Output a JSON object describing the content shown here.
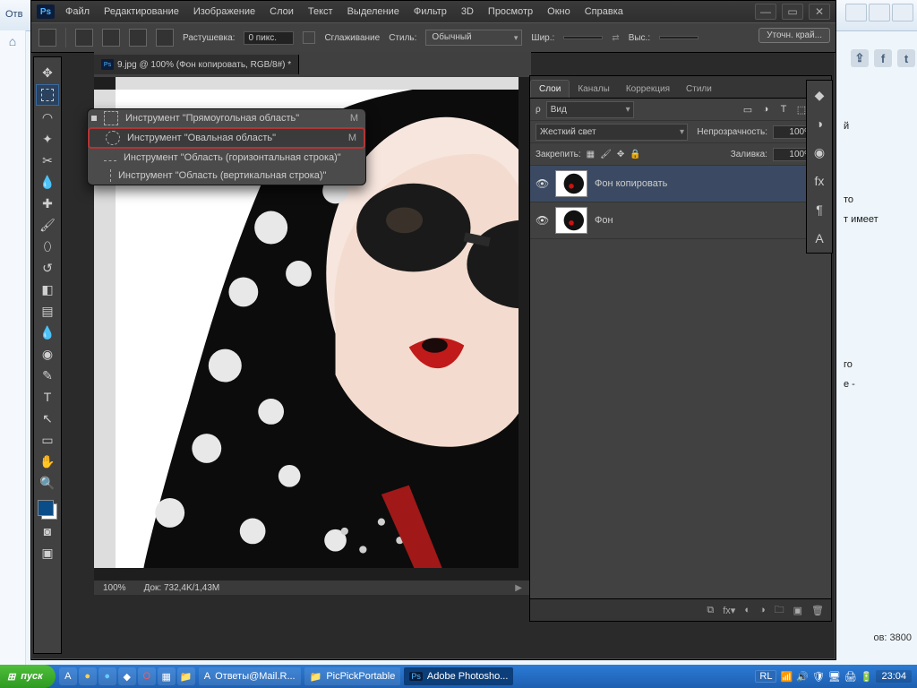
{
  "browser": {
    "left_label": "Отв",
    "side_text_lines": [
      "й",
      "то",
      "т имеет",
      "го",
      "е -"
    ],
    "likes_label": "ов: 3800"
  },
  "ps": {
    "menu": [
      "Файл",
      "Редактирование",
      "Изображение",
      "Слои",
      "Текст",
      "Выделение",
      "Фильтр",
      "3D",
      "Просмотр",
      "Окно",
      "Справка"
    ],
    "logo": "Ps",
    "window_buttons": [
      "—",
      "▭",
      "✕"
    ],
    "options": {
      "feather_label": "Растушевка:",
      "feather_value": "0 пикс.",
      "antialias_label": "Сглаживание",
      "style_label": "Стиль:",
      "style_value": "Обычный",
      "width_label": "Шир.:",
      "height_label": "Выс.:",
      "refine_btn": "Уточн. край..."
    },
    "doc_title": "9.jpg @ 100% (Фон копировать, RGB/8#) *",
    "status": {
      "zoom": "100%",
      "doc": "Док: 732,4K/1,43M"
    },
    "marquee_flyout": {
      "items": [
        {
          "label": "Инструмент \"Прямоугольная область\"",
          "key": "M",
          "active": false,
          "shape": "rect"
        },
        {
          "label": "Инструмент \"Овальная область\"",
          "key": "M",
          "active": true,
          "shape": "ell"
        },
        {
          "label": "Инструмент \"Область (горизонтальная строка)\"",
          "key": "",
          "active": false,
          "shape": "lineH"
        },
        {
          "label": "Инструмент \"Область (вертикальная строка)\"",
          "key": "",
          "active": false,
          "shape": "lineV"
        }
      ]
    },
    "tools": [
      "↔",
      "▭",
      "◌",
      "✦",
      "✂",
      "🖊",
      "🧪",
      "🖌",
      "🖌",
      "⬯",
      "🖌",
      "◌",
      "✎",
      "T",
      "↖",
      "✋",
      "🤚",
      "🔍"
    ]
  },
  "layers_panel": {
    "tabs": [
      "Слои",
      "Каналы",
      "Коррекция",
      "Стили"
    ],
    "kind_label": "Вид",
    "blend_mode": "Жесткий свет",
    "opacity_label": "Непрозрачность:",
    "opacity_value": "100%",
    "lock_label": "Закрепить:",
    "fill_label": "Заливка:",
    "fill_value": "100%",
    "layers": [
      {
        "name": "Фон копировать",
        "visible": true,
        "locked": false,
        "selected": true
      },
      {
        "name": "Фон",
        "visible": true,
        "locked": true,
        "selected": false
      }
    ],
    "filter_icons": [
      "▭",
      "◑",
      "T",
      "⬚",
      "◆"
    ]
  },
  "taskbar": {
    "start": "пуск",
    "items": [
      {
        "label": "Ответы@Mail.R...",
        "active": false
      },
      {
        "label": "PicPickPortable",
        "active": false
      },
      {
        "label": "Adobe Photosho...",
        "active": true
      }
    ],
    "lang": "RL",
    "clock": "23:04"
  }
}
